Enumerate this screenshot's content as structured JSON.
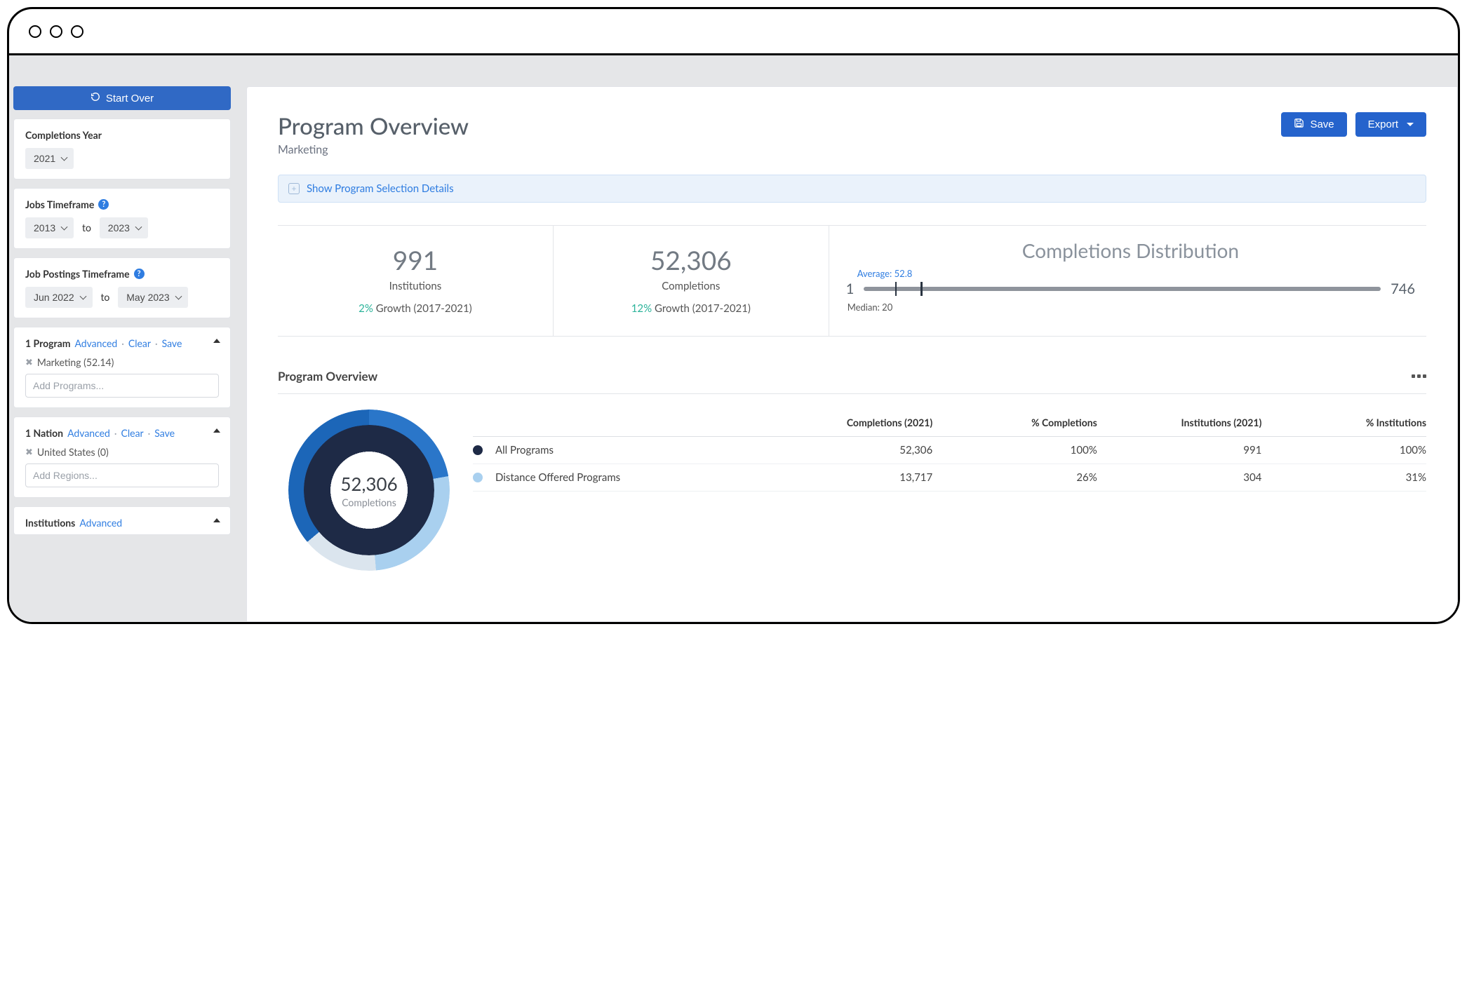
{
  "sidebar": {
    "start_over": "Start Over",
    "completions_year": {
      "title": "Completions Year",
      "value": "2021"
    },
    "jobs_timeframe": {
      "title": "Jobs Timeframe",
      "from": "2013",
      "to_label": "to",
      "to": "2023"
    },
    "postings_timeframe": {
      "title": "Job Postings Timeframe",
      "from": "Jun 2022",
      "to_label": "to",
      "to": "May 2023"
    },
    "programs": {
      "title": "1 Program",
      "advanced": "Advanced",
      "clear": "Clear",
      "save": "Save",
      "selected": "Marketing (52.14)",
      "placeholder": "Add Programs..."
    },
    "regions": {
      "title": "1 Nation",
      "advanced": "Advanced",
      "clear": "Clear",
      "save": "Save",
      "selected": "United States (0)",
      "placeholder": "Add Regions..."
    },
    "institutions": {
      "title": "Institutions",
      "advanced": "Advanced"
    }
  },
  "header": {
    "title": "Program Overview",
    "subtitle": "Marketing",
    "save": "Save",
    "export": "Export"
  },
  "banner": {
    "label": "Show Program Selection Details"
  },
  "kpi": {
    "institutions": {
      "value": "991",
      "label": "Institutions",
      "growth_pct": "2%",
      "growth_label": "Growth (2017-2021)"
    },
    "completions": {
      "value": "52,306",
      "label": "Completions",
      "growth_pct": "12%",
      "growth_label": "Growth (2017-2021)"
    }
  },
  "distribution": {
    "title": "Completions Distribution",
    "average_label": "Average: 52.8",
    "min": "1",
    "max": "746",
    "median_label": "Median: 20"
  },
  "section": {
    "title": "Program Overview"
  },
  "donut": {
    "center_value": "52,306",
    "center_label": "Completions"
  },
  "table": {
    "headers": {
      "completions": "Completions (2021)",
      "pct_completions": "% Completions",
      "institutions": "Institutions (2021)",
      "pct_institutions": "% Institutions"
    },
    "rows": [
      {
        "name": "All Programs",
        "completions": "52,306",
        "pct_completions": "100%",
        "institutions": "991",
        "pct_institutions": "100%",
        "dot": "legend-navy"
      },
      {
        "name": "Distance Offered Programs",
        "completions": "13,717",
        "pct_completions": "26%",
        "institutions": "304",
        "pct_institutions": "31%",
        "dot": "legend-light"
      }
    ]
  },
  "chart_data": {
    "type": "pie",
    "title": "Program Overview — Completions (2021)",
    "center_value": 52306,
    "center_label": "Completions",
    "series": [
      {
        "name": "All Programs",
        "completions": 52306,
        "pct_completions": 100,
        "institutions": 991,
        "pct_institutions": 100
      },
      {
        "name": "Distance Offered Programs",
        "completions": 13717,
        "pct_completions": 26,
        "institutions": 304,
        "pct_institutions": 31
      }
    ],
    "distribution": {
      "min": 1,
      "max": 746,
      "average": 52.8,
      "median": 20
    }
  }
}
